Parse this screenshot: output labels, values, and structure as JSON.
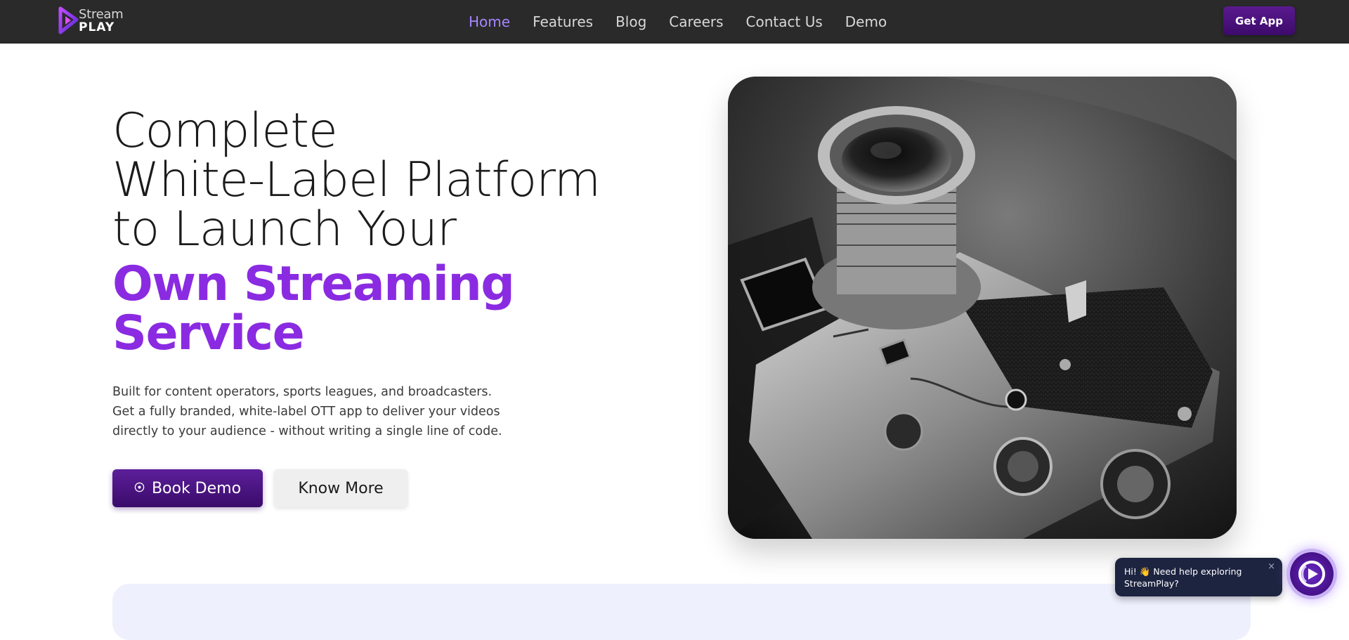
{
  "brand": {
    "logo_top": "Stream",
    "logo_bottom": "PLAY",
    "logo_icon": "play-triangle-icon",
    "accent_color": "#8a2be2",
    "nav_background": "#2a2a2a"
  },
  "nav": {
    "links": [
      {
        "label": "Home",
        "active": true
      },
      {
        "label": "Features",
        "active": false
      },
      {
        "label": "Blog",
        "active": false
      },
      {
        "label": "Careers",
        "active": false
      },
      {
        "label": "Contact Us",
        "active": false
      },
      {
        "label": "Demo",
        "active": false
      }
    ],
    "get_app_label": "Get App"
  },
  "hero": {
    "title_lines": [
      "Complete",
      "White-Label Platform",
      "to Launch Your"
    ],
    "accent_lines": [
      "Own Streaming",
      "Service"
    ],
    "description_lines": [
      "Built for content operators, sports leagues, and broadcasters.",
      "Get a fully branded, white-label OTT app to deliver your videos",
      "directly to your audience - without writing a single line of code."
    ],
    "primary_button": {
      "label": "Book Demo",
      "icon": "play-circle-icon"
    },
    "secondary_button": {
      "label": "Know More"
    }
  },
  "chat": {
    "message_lines": [
      "Hi! 👋 Need help exploring",
      "StreamPlay?"
    ],
    "close_label": "×",
    "launcher_icon": "streamplay-logo-icon"
  }
}
